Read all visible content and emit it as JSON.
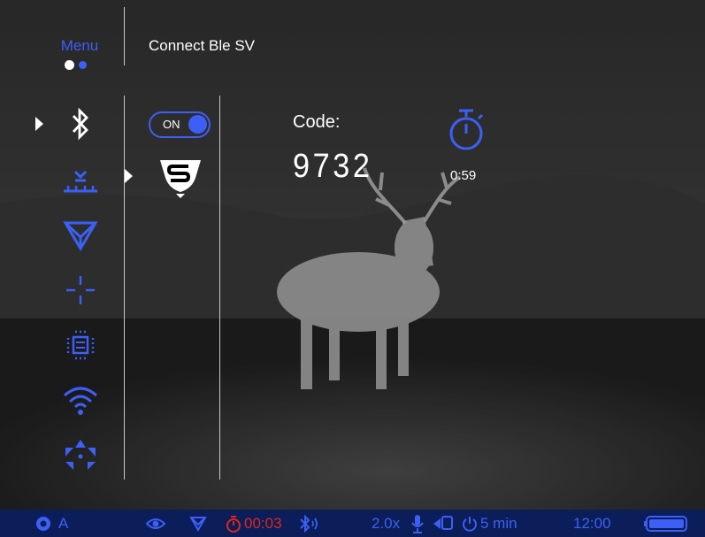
{
  "menu": {
    "title": "Menu",
    "page_dots": [
      "active",
      "inactive"
    ],
    "items": [
      {
        "icon": "bluetooth-icon",
        "selected": true
      },
      {
        "icon": "distance-icon",
        "selected": false
      },
      {
        "icon": "rangefinder-triangle-icon",
        "selected": false
      },
      {
        "icon": "reticle-icon",
        "selected": false
      },
      {
        "icon": "chip-icon",
        "selected": false
      },
      {
        "icon": "wifi-icon",
        "selected": false
      },
      {
        "icon": "expand-arrows-icon",
        "selected": false
      }
    ]
  },
  "submenu": {
    "title": "Connect Ble SV",
    "toggle_label": "ON",
    "toggle_state": "on",
    "device_icon": "stream-vision-logo-icon"
  },
  "pairing": {
    "code_label": "Code:",
    "code_value": "9732",
    "timer_icon": "stopwatch-icon",
    "timer_value": "0:59"
  },
  "status_bar": {
    "mode": "A",
    "mode_icon": "circle-mode-icon",
    "view_icon": "eye-icon",
    "rangefinder_icon": "triangle-icon",
    "timer_value": "00:03",
    "timer_icon": "stopwatch-icon",
    "bluetooth_icon": "bluetooth-connected-icon",
    "zoom": "2.0x",
    "mic_icon": "microphone-icon",
    "record_icon": "camera-record-icon",
    "auto_off": "5 min",
    "power_icon": "power-icon",
    "clock": "12:00",
    "battery_icon": "battery-icon",
    "battery_level": 1.0
  },
  "colors": {
    "accent": "#3d5ff5",
    "timer_red": "#e0261c",
    "status_bg": "#0b1e59",
    "text": "#ffffff"
  }
}
